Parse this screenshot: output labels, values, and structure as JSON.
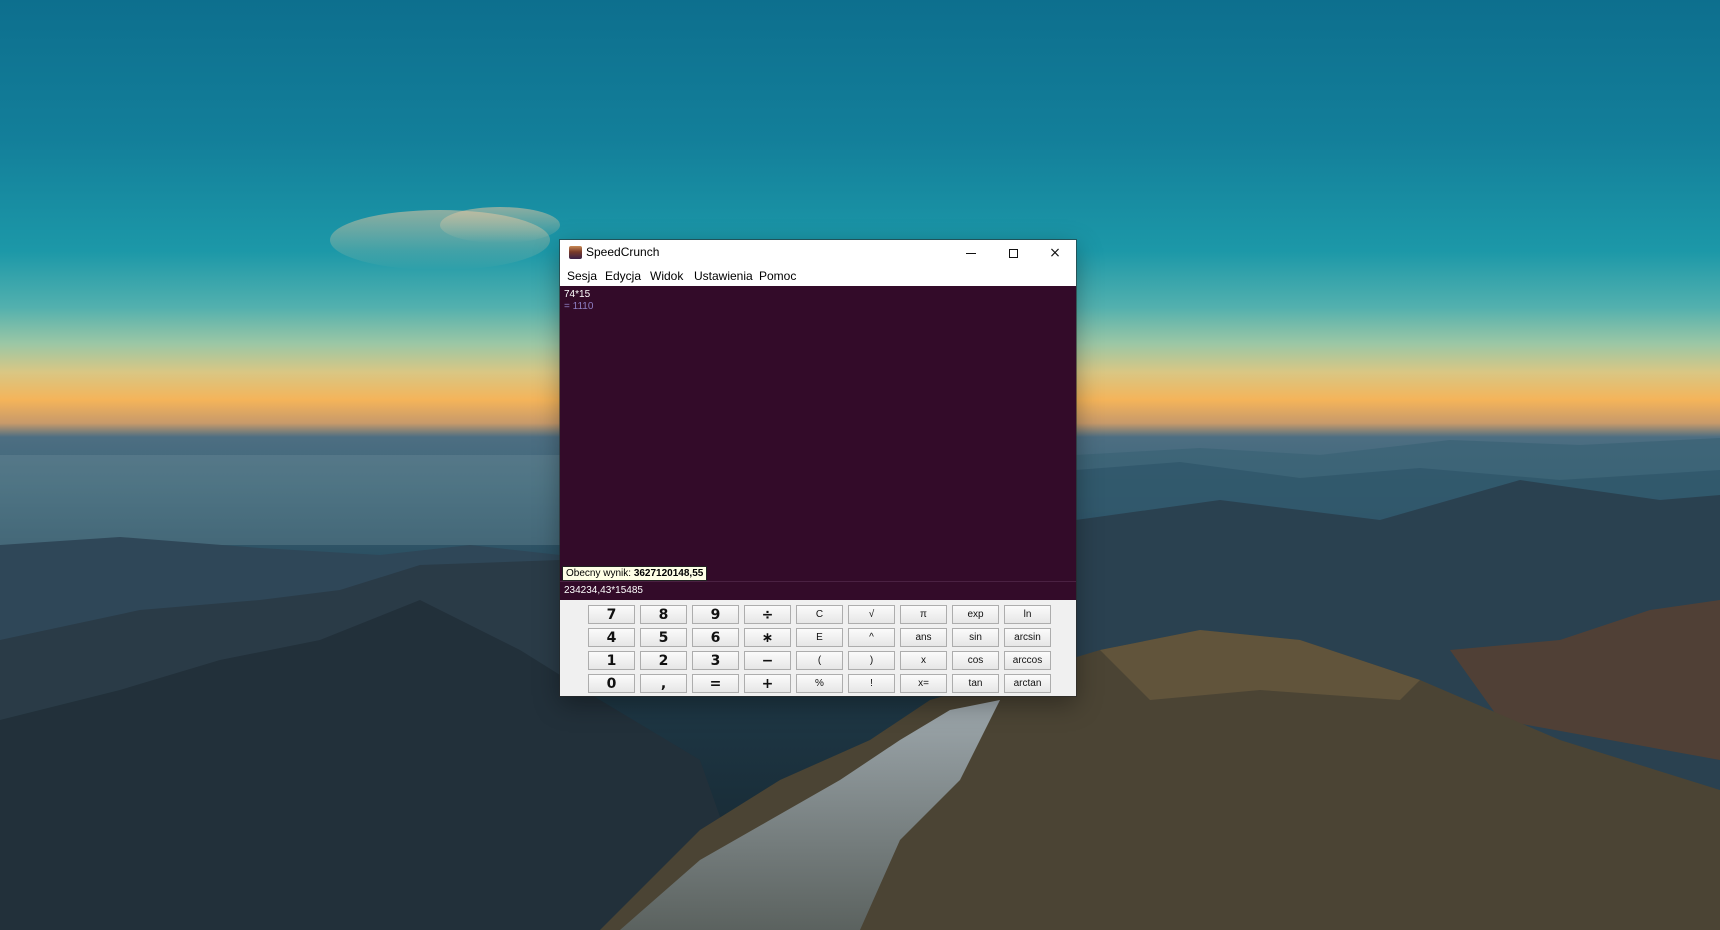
{
  "window": {
    "title": "SpeedCrunch",
    "icon": "speedcrunch-app-icon",
    "controls": {
      "minimize": "minimize-icon",
      "maximize": "maximize-icon",
      "close": "×"
    }
  },
  "menu": [
    "Sesja",
    "Edycja",
    "Widok",
    "Ustawienia",
    "Pomoc"
  ],
  "history": [
    {
      "expression": "74*15",
      "result": "= 1110"
    }
  ],
  "current_result": {
    "label": "Obecny wynik:",
    "value": "3627120148,55"
  },
  "editor": {
    "text": "234234,43*15485"
  },
  "keypad": {
    "rows": [
      [
        "7",
        "8",
        "9",
        "÷",
        "C",
        "√",
        "π",
        "exp",
        "ln"
      ],
      [
        "4",
        "5",
        "6",
        "∗",
        "E",
        "^",
        "ans",
        "sin",
        "arcsin"
      ],
      [
        "1",
        "2",
        "3",
        "−",
        "(",
        ")",
        "x",
        "cos",
        "arccos"
      ],
      [
        "0",
        ",",
        "=",
        "+",
        "%",
        "!",
        "x=",
        "tan",
        "arctan"
      ]
    ]
  },
  "colors": {
    "display_bg": "#330b29",
    "result_text": "#8e7ec3",
    "badge_bg": "#ffffe6"
  }
}
